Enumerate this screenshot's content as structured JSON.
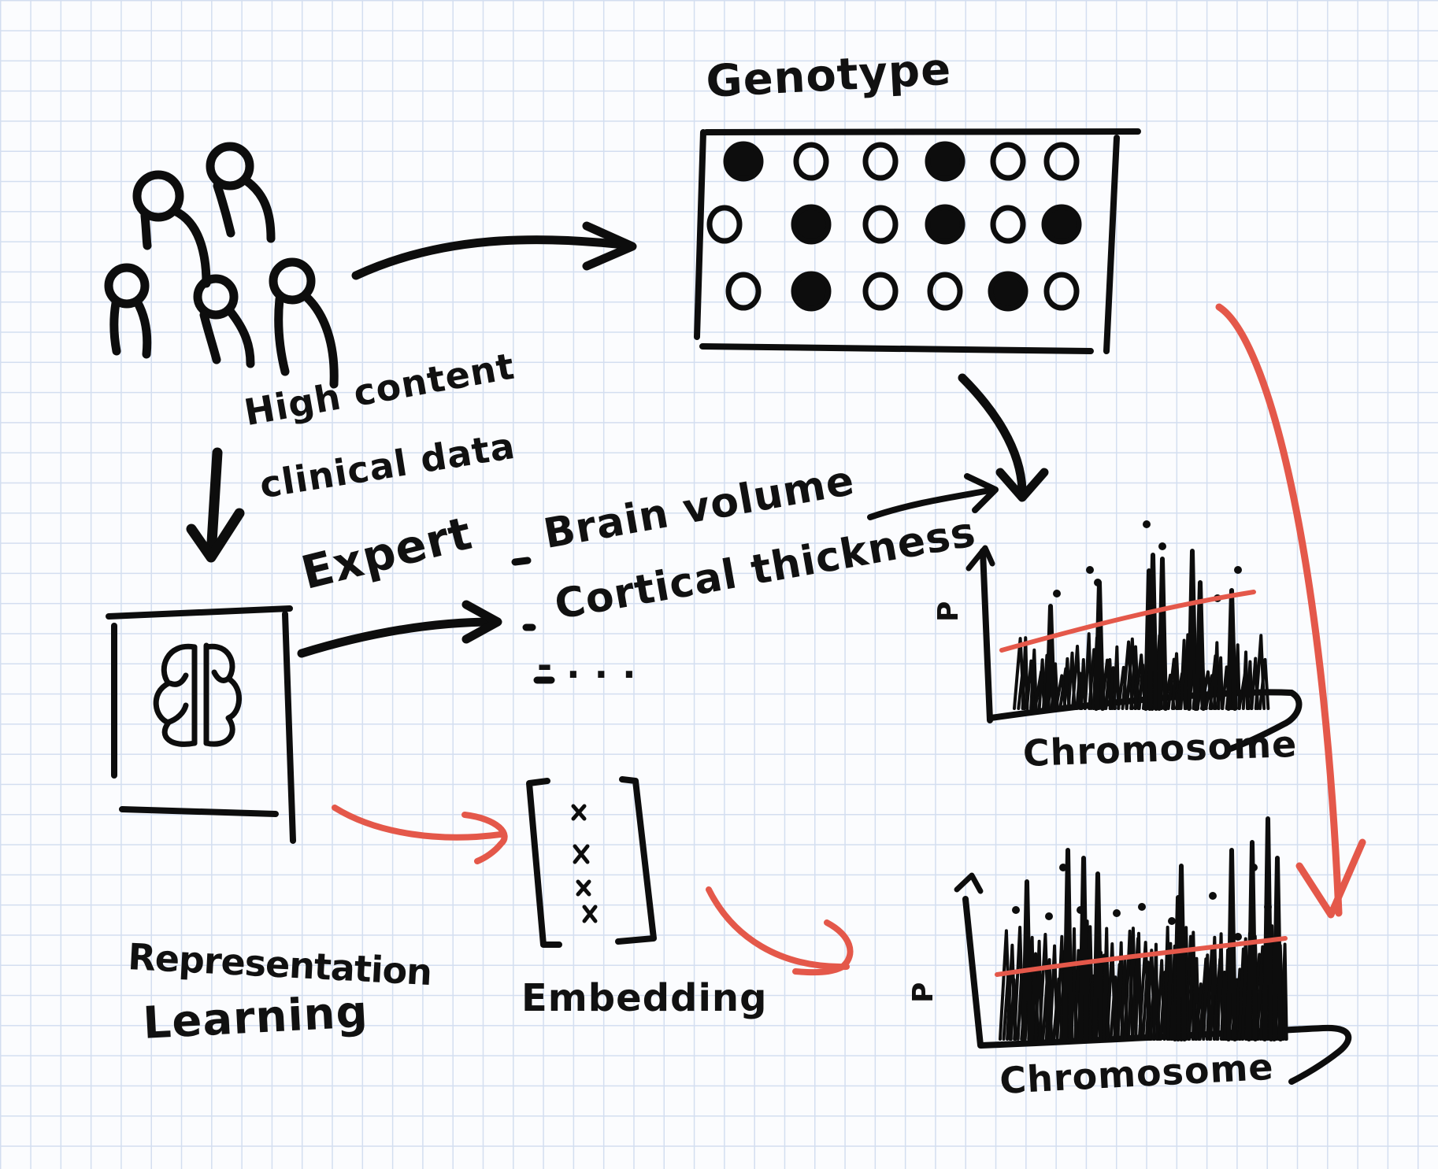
{
  "labels": {
    "genotype": "Genotype",
    "clinical_line1": "High content",
    "clinical_line2": "clinical data",
    "expert": "Expert",
    "brain_volume": "Brain volume",
    "cortical_thickness": "Cortical thickness",
    "ellipsis": "- . . .",
    "embedding": "Embedding",
    "representation_line1": "Representation",
    "representation_line2": "Learning",
    "top_plot_ylabel": "P",
    "top_plot_xlabel": "Chromosome",
    "bottom_plot_ylabel": "P",
    "bottom_plot_xlabel": "Chromosome"
  },
  "genotype_grid": [
    [
      1,
      0,
      0,
      1,
      0,
      0
    ],
    [
      0,
      1,
      0,
      1,
      0,
      1
    ],
    [
      0,
      1,
      0,
      0,
      1,
      0
    ]
  ],
  "colors": {
    "ink": "#0d0d0d",
    "accent": "#e4584a"
  },
  "icons": [
    "people-icon",
    "brain-scan-icon"
  ]
}
